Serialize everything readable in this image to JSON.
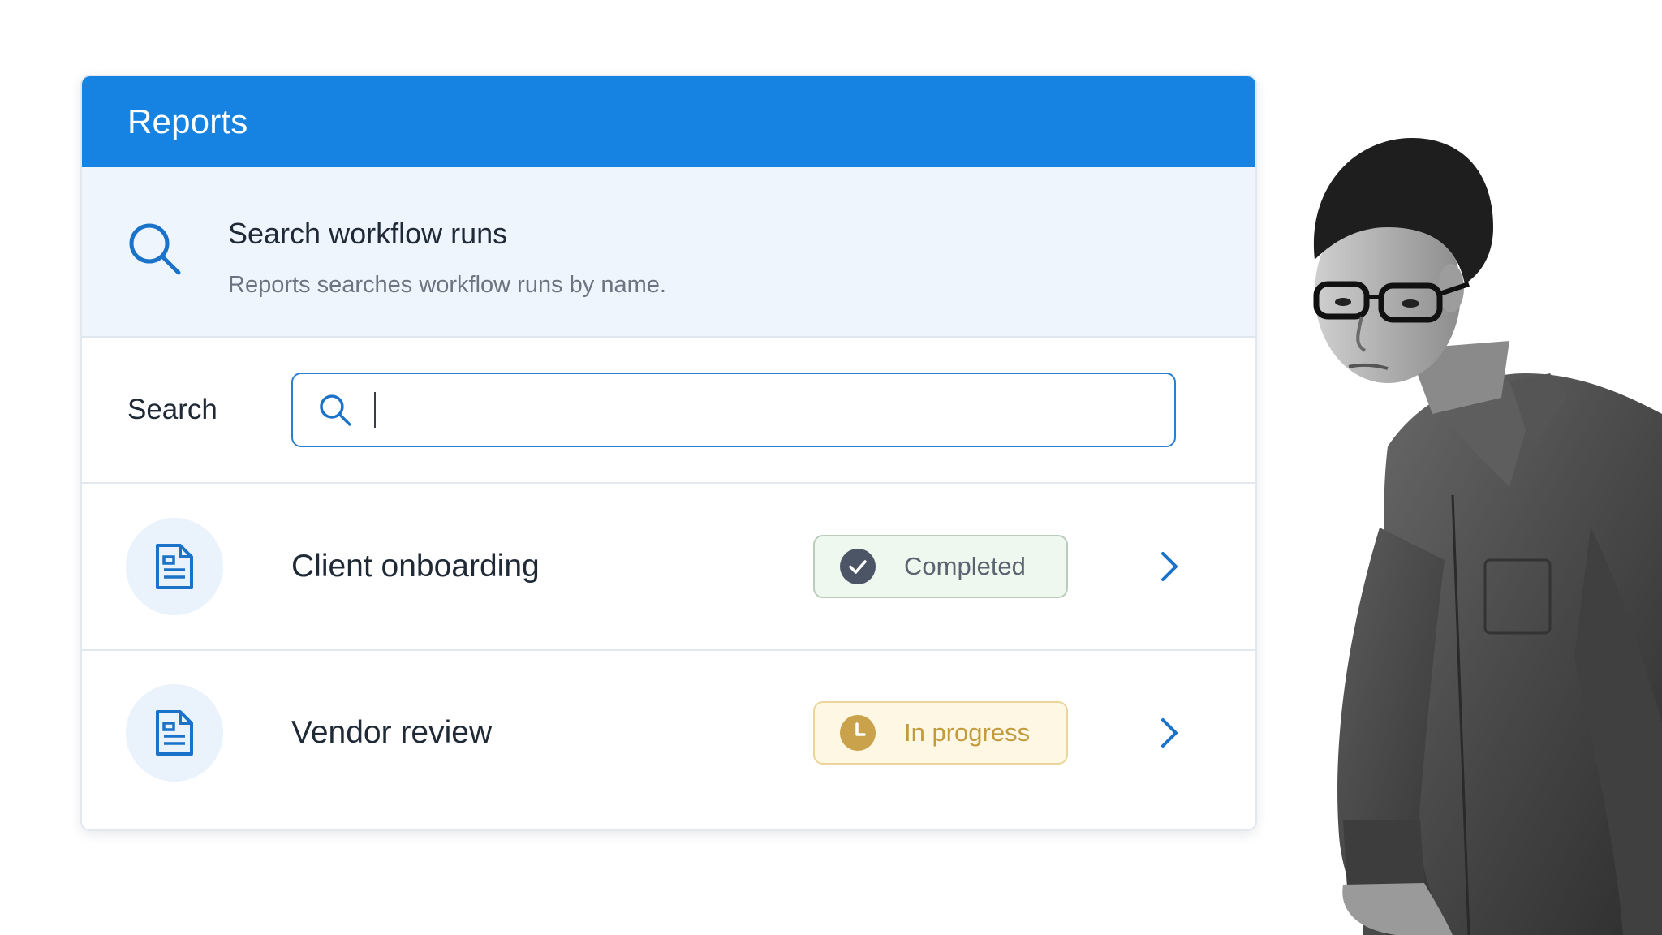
{
  "header": {
    "title": "Reports"
  },
  "info": {
    "icon": "search-icon",
    "title": "Search workflow runs",
    "description": "Reports searches workflow runs by name."
  },
  "search": {
    "label": "Search",
    "value": "",
    "placeholder": ""
  },
  "runs": [
    {
      "icon": "document-icon",
      "name": "Client onboarding",
      "status": "Completed",
      "status_icon": "check-circle-icon"
    },
    {
      "icon": "document-icon",
      "name": "Vendor review",
      "status": "In progress",
      "status_icon": "clock-icon"
    }
  ],
  "colors": {
    "header": "#1683e2",
    "accent": "#1a73c9",
    "completed_bg": "#eff8ef",
    "in_progress_bg": "#fdf7e4"
  }
}
